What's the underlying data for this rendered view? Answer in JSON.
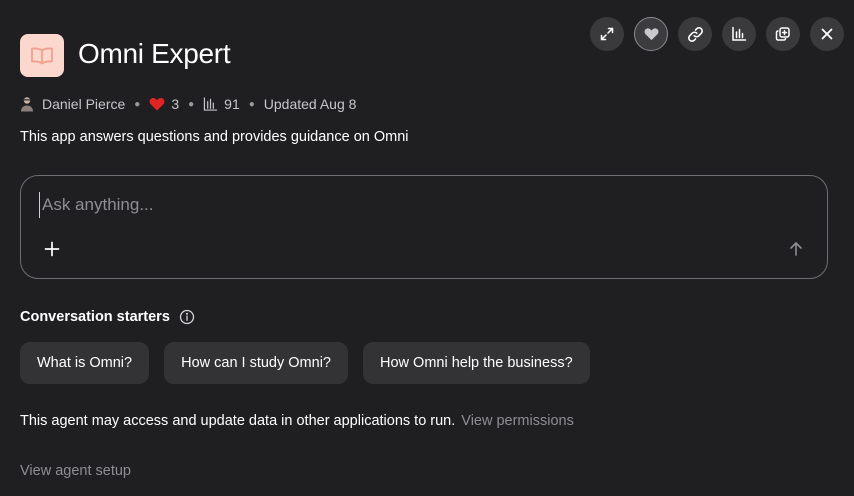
{
  "app": {
    "title": "Omni Expert",
    "icon": "book-icon",
    "icon_bg": "#fcd7cd"
  },
  "toolbar": {
    "buttons": [
      {
        "icon": "expand-icon"
      },
      {
        "icon": "heart-icon",
        "active": true
      },
      {
        "icon": "link-icon"
      },
      {
        "icon": "bar-chart-icon"
      },
      {
        "icon": "duplicate-icon"
      },
      {
        "icon": "close-icon"
      }
    ]
  },
  "meta": {
    "author": "Daniel Pierce",
    "likes": "3",
    "usage": "91",
    "updated": "Updated Aug 8",
    "heart_color": "#e02424"
  },
  "description": "This app answers questions and provides guidance on Omni",
  "ask": {
    "placeholder": "Ask anything...",
    "value": ""
  },
  "starters": {
    "heading": "Conversation starters",
    "items": [
      "What is Omni?",
      "How can I study Omni?",
      "How Omni help the business?"
    ]
  },
  "permissions": {
    "text": "This agent may access and update data in other applications to run.",
    "link": "View permissions"
  },
  "setup_link": "View agent setup"
}
